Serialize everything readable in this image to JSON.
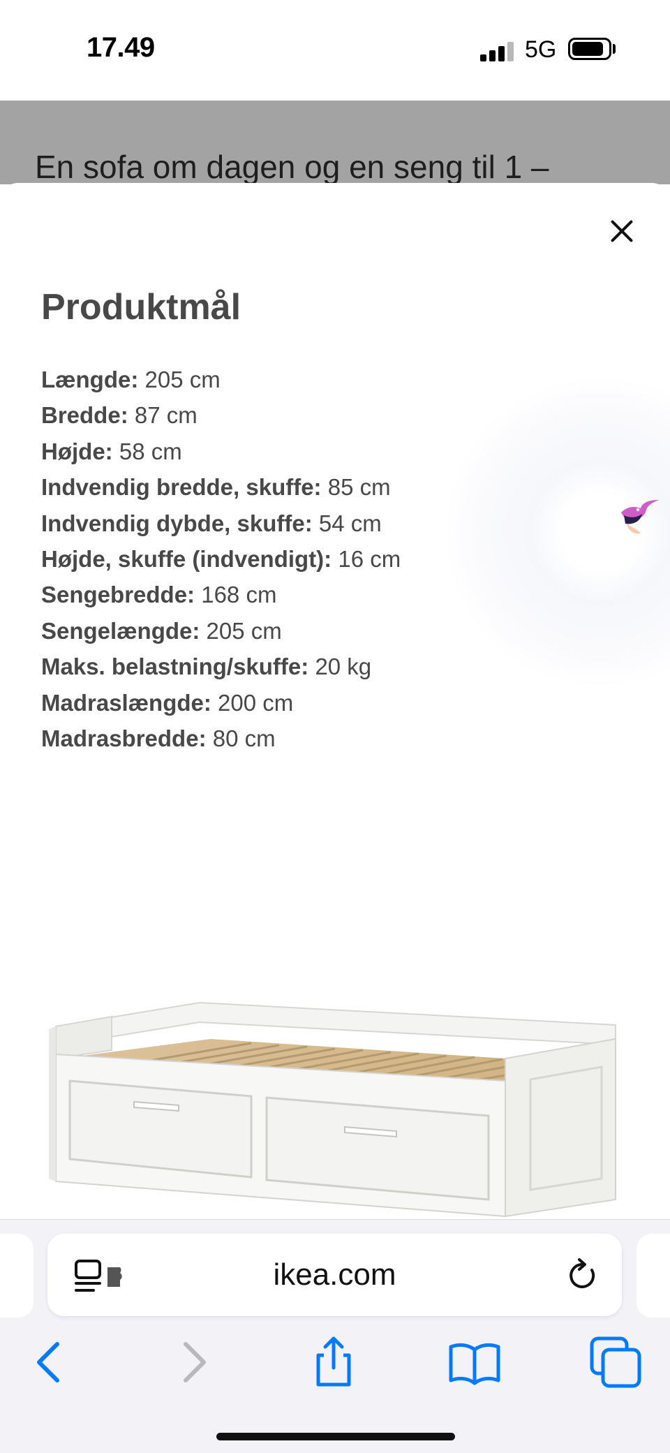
{
  "status_bar": {
    "time": "17.49",
    "network": "5G",
    "signal_bars": 3,
    "battery_level": 0.75
  },
  "background_page": {
    "heading_fragment": "En sofa om dagen og en seng til 1 –"
  },
  "sheet": {
    "title": "Produktmål",
    "dimensions": [
      {
        "label": "Længde:",
        "value": "205 cm"
      },
      {
        "label": "Bredde:",
        "value": "87 cm"
      },
      {
        "label": "Højde:",
        "value": "58 cm"
      },
      {
        "label": "Indvendig bredde, skuffe:",
        "value": "85 cm"
      },
      {
        "label": "Indvendig dybde, skuffe:",
        "value": "54 cm"
      },
      {
        "label": "Højde, skuffe (indvendigt):",
        "value": "16 cm"
      },
      {
        "label": "Sengebredde:",
        "value": "168 cm"
      },
      {
        "label": "Sengelængde:",
        "value": "205 cm"
      },
      {
        "label": "Maks. belastning/skuffe:",
        "value": "20 kg"
      },
      {
        "label": "Madraslængde:",
        "value": "200 cm"
      },
      {
        "label": "Madrasbredde:",
        "value": "80 cm"
      }
    ]
  },
  "browser": {
    "url": "ikea.com",
    "toolbar": [
      "back-icon",
      "forward-icon",
      "share-icon",
      "bookmarks-icon",
      "tabs-icon"
    ]
  },
  "colors": {
    "accent": "#007aff",
    "text_dark": "#484848",
    "dim_overlay": "#a3a3a3"
  }
}
